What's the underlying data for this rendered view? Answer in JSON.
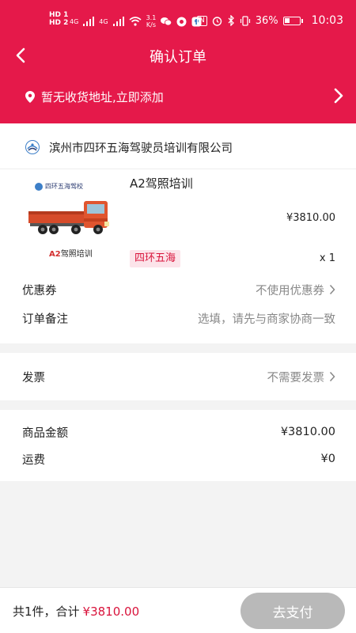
{
  "status_bar": {
    "hd1": "HD 1",
    "hd2": "HD 2",
    "net1": "4G",
    "net2": "4G",
    "speed_value": "3.1",
    "speed_unit": "K/s",
    "nfc": "N",
    "battery_pct": "36%",
    "time": "10:03"
  },
  "header": {
    "title": "确认订单"
  },
  "address": {
    "text": "暂无收货地址,立即添加"
  },
  "shop": {
    "name": "滨州市四环五海驾驶员培训有限公司"
  },
  "product": {
    "image_brand": "四环五海驾校",
    "image_caption_prefix": "A2",
    "image_caption_suffix": "驾照培训",
    "name": "A2驾照培训",
    "price": "¥3810.00",
    "tag": "四环五海",
    "quantity": "x 1"
  },
  "coupon": {
    "label": "优惠券",
    "value": "不使用优惠券"
  },
  "remark": {
    "label": "订单备注",
    "placeholder": "选填，请先与商家协商一致"
  },
  "invoice": {
    "label": "发票",
    "value": "不需要发票"
  },
  "summary": {
    "goods_label": "商品金额",
    "goods_value": "¥3810.00",
    "freight_label": "运费",
    "freight_value": "¥0"
  },
  "footer": {
    "count_text": "共1件，合计",
    "total": "¥3810.00",
    "pay_label": "去支付"
  },
  "colors": {
    "brand": "#e5194a",
    "price_accent": "#d9143c",
    "pay_disabled": "#b9b9b9"
  }
}
